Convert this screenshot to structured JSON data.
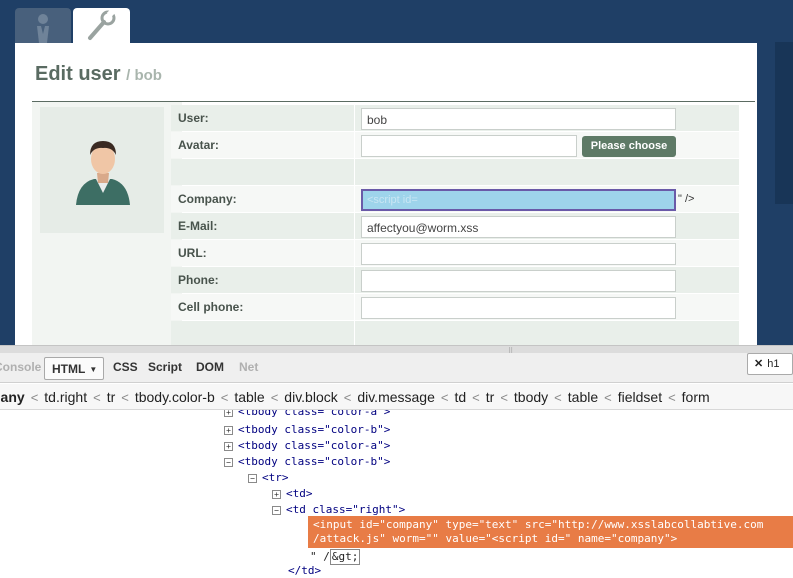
{
  "app": {
    "tabs": [
      {
        "name": "users-tab",
        "icon": "user-icon"
      },
      {
        "name": "settings-tab",
        "icon": "wrench-icon"
      }
    ],
    "panel": {
      "title": "Edit user",
      "subtitle": "/ bob"
    },
    "avatar_icon": "user-avatar-icon",
    "form": {
      "user": {
        "label": "User:",
        "value": "bob"
      },
      "avatar": {
        "label": "Avatar:",
        "value": "",
        "button": "Please choose"
      },
      "company": {
        "label": "Company:",
        "value": "<script id=",
        "tail": "\" />"
      },
      "email": {
        "label": "E-Mail:",
        "value": "affectyou@worm.xss"
      },
      "url": {
        "label": "URL:",
        "value": ""
      },
      "phone": {
        "label": "Phone:",
        "value": ""
      },
      "cell": {
        "label": "Cell phone:",
        "value": ""
      }
    }
  },
  "firebug": {
    "tabs": [
      "Console",
      "HTML",
      "CSS",
      "Script",
      "DOM",
      "Net"
    ],
    "active_tab": "HTML",
    "search": "h1",
    "breadcrumb": [
      "pany",
      "td.right",
      "tr",
      "tbody.color-b",
      "table",
      "div.block",
      "div.message",
      "td",
      "tr",
      "tbody",
      "table",
      "fieldset",
      "form"
    ],
    "tree": {
      "l0": "<tbody class=\"color-a\">",
      "l1": "<tbody class=\"color-b\">",
      "l2": "<tbody class=\"color-a\">",
      "l3": "<tbody class=\"color-b\">",
      "l4": "<tr>",
      "l5": "<td>",
      "l6": "<td class=\"right\">",
      "hl1": "<input id=\"company\" type=\"text\" src=\"http://www.xsslabcollabtive.com",
      "hl2": "/attack.js\" worm=\"\" value=\"<script id=\" name=\"company\">",
      "l9a": "\" /",
      "l9b": "&gt;",
      "l10": "</td>"
    }
  }
}
